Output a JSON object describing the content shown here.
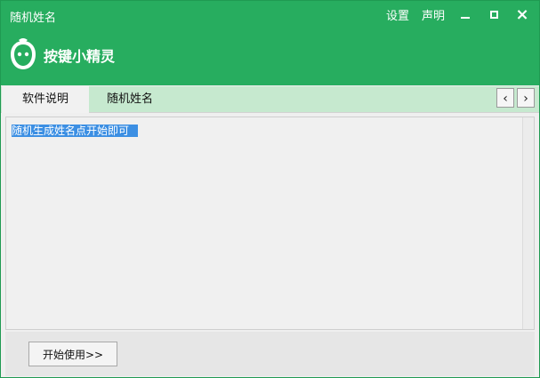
{
  "window": {
    "title": "随机姓名",
    "links": {
      "settings": "设置",
      "statement": "声明"
    },
    "controls": {
      "minimize": "minimize-icon",
      "maximize": "maximize-icon",
      "close": "close-icon"
    }
  },
  "logo": {
    "text": "按键小精灵",
    "icon": "sprite-logo-icon"
  },
  "tabs": [
    {
      "label": "软件说明",
      "active": true
    },
    {
      "label": "随机姓名",
      "active": false
    }
  ],
  "tab_nav": {
    "prev": "‹",
    "next": "›"
  },
  "content": {
    "text": "随机生成姓名点开始即可"
  },
  "footer": {
    "start_button": "开始使用>>"
  },
  "colors": {
    "accent": "#27ad5f",
    "tab_bar": "#c6e9cf",
    "selection": "#3c8fe3"
  }
}
